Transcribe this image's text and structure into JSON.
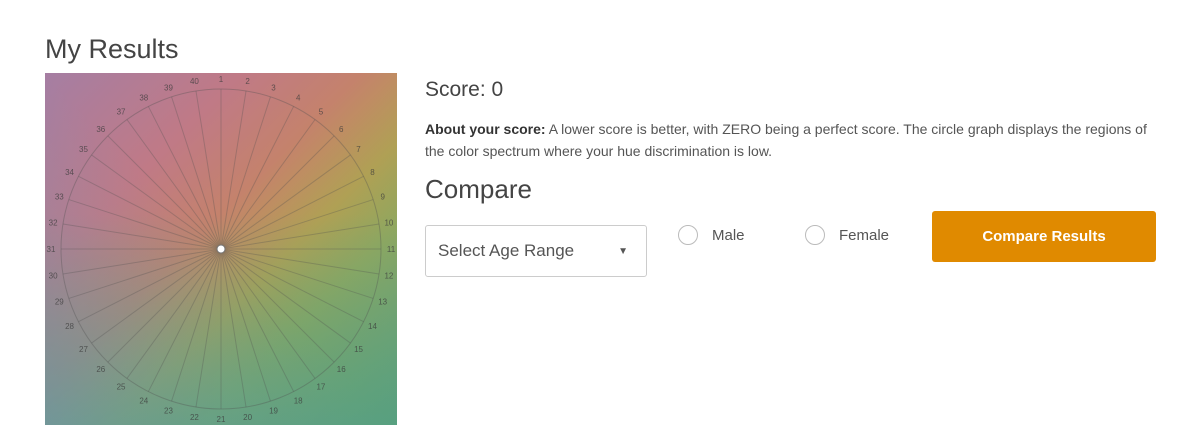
{
  "page": {
    "title": "My Results"
  },
  "wheel": {
    "segment_labels": [
      "1",
      "2",
      "3",
      "4",
      "5",
      "6",
      "7",
      "8",
      "9",
      "10",
      "11",
      "12",
      "13",
      "14",
      "15",
      "16",
      "17",
      "18",
      "19",
      "20",
      "21",
      "22",
      "23",
      "24",
      "25",
      "26",
      "27",
      "28",
      "29",
      "30",
      "31",
      "32",
      "33",
      "34",
      "35",
      "36",
      "37",
      "38",
      "39",
      "40"
    ],
    "score_value": 0
  },
  "results": {
    "score_text": "Score: 0",
    "about_label": "About your score:",
    "about_text": " A lower score is better, with ZERO being a perfect score. The circle graph displays the regions of the color spectrum where your hue discrimination is low."
  },
  "compare": {
    "title": "Compare",
    "age_select": {
      "selected": "Select Age Range"
    },
    "radio_male": "Male",
    "radio_female": "Female",
    "button_label": "Compare Results",
    "button_color": "#e08a00"
  }
}
